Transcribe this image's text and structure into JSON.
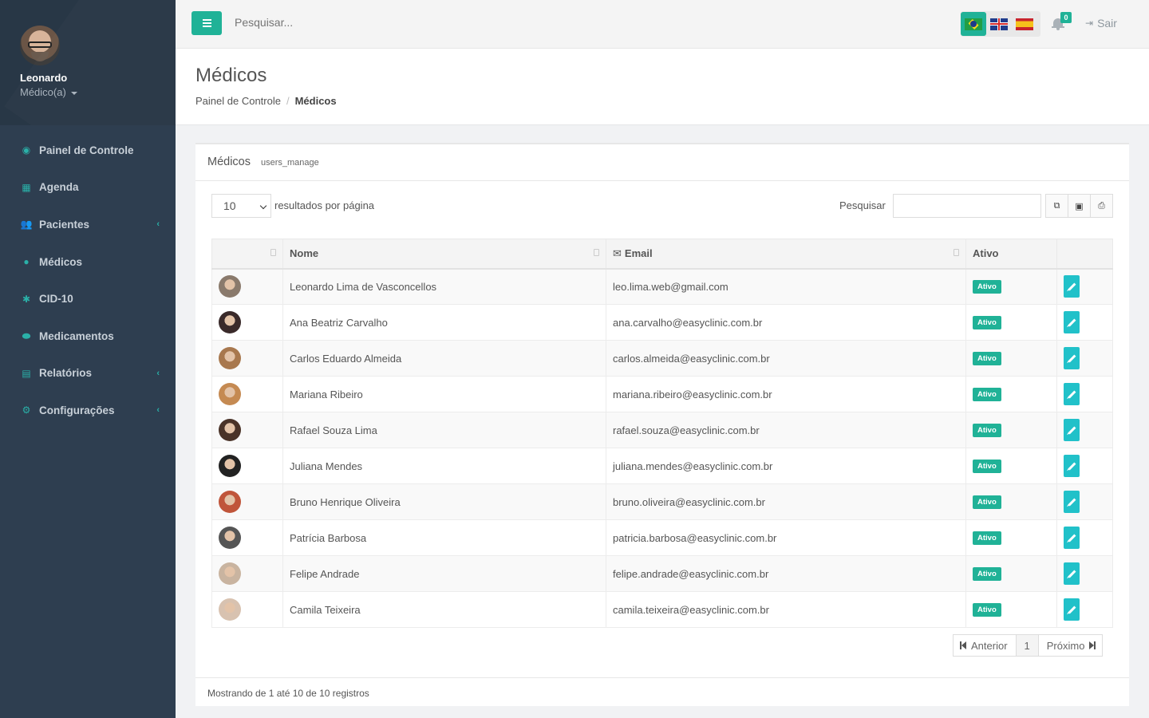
{
  "sidebar": {
    "user_name": "Leonardo",
    "user_role": "Médico(a)",
    "items": [
      {
        "label": "Painel de Controle",
        "icon": "dashboard-icon",
        "glyph": "◉",
        "has_submenu": false
      },
      {
        "label": "Agenda",
        "icon": "calendar-icon",
        "glyph": "▦",
        "has_submenu": false
      },
      {
        "label": "Pacientes",
        "icon": "users-icon",
        "glyph": "👥",
        "has_submenu": true
      },
      {
        "label": "Médicos",
        "icon": "user-md-icon",
        "glyph": "●",
        "has_submenu": false
      },
      {
        "label": "CID-10",
        "icon": "bug-icon",
        "glyph": "✱",
        "has_submenu": false
      },
      {
        "label": "Medicamentos",
        "icon": "pill-icon",
        "glyph": "⬬",
        "has_submenu": false
      },
      {
        "label": "Relatórios",
        "icon": "report-icon",
        "glyph": "▤",
        "has_submenu": true
      },
      {
        "label": "Configurações",
        "icon": "cogs-icon",
        "glyph": "⚙",
        "has_submenu": true
      }
    ]
  },
  "topbar": {
    "search_placeholder": "Pesquisar...",
    "notification_count": "0",
    "logout_label": "Sair",
    "languages": [
      "pt-BR",
      "en-GB",
      "es"
    ]
  },
  "header": {
    "title": "Médicos",
    "breadcrumb": [
      "Painel de Controle",
      "Médicos"
    ]
  },
  "card": {
    "title": "Médicos",
    "subtitle": "users_manage",
    "page_length": "10",
    "page_length_label": "resultados por página",
    "search_label": "Pesquisar",
    "columns": [
      "",
      "Nome",
      "Email",
      "Ativo",
      ""
    ],
    "rows": [
      {
        "name": "Leonardo Lima de Vasconcellos",
        "email": "leo.lima.web@gmail.com",
        "status": "Ativo",
        "avatar_color": "#8a7a6c"
      },
      {
        "name": "Ana Beatriz Carvalho",
        "email": "ana.carvalho@easyclinic.com.br",
        "status": "Ativo",
        "avatar_color": "#3a2a2a"
      },
      {
        "name": "Carlos Eduardo Almeida",
        "email": "carlos.almeida@easyclinic.com.br",
        "status": "Ativo",
        "avatar_color": "#a8784e"
      },
      {
        "name": "Mariana Ribeiro",
        "email": "mariana.ribeiro@easyclinic.com.br",
        "status": "Ativo",
        "avatar_color": "#c58a52"
      },
      {
        "name": "Rafael Souza Lima",
        "email": "rafael.souza@easyclinic.com.br",
        "status": "Ativo",
        "avatar_color": "#4a3328"
      },
      {
        "name": "Juliana Mendes",
        "email": "juliana.mendes@easyclinic.com.br",
        "status": "Ativo",
        "avatar_color": "#222222"
      },
      {
        "name": "Bruno Henrique Oliveira",
        "email": "bruno.oliveira@easyclinic.com.br",
        "status": "Ativo",
        "avatar_color": "#c0553a"
      },
      {
        "name": "Patrícia Barbosa",
        "email": "patricia.barbosa@easyclinic.com.br",
        "status": "Ativo",
        "avatar_color": "#555555"
      },
      {
        "name": "Felipe Andrade",
        "email": "felipe.andrade@easyclinic.com.br",
        "status": "Ativo",
        "avatar_color": "#c9b4a0"
      },
      {
        "name": "Camila Teixeira",
        "email": "camila.teixeira@easyclinic.com.br",
        "status": "Ativo",
        "avatar_color": "#d8c2b0"
      }
    ],
    "pager": {
      "prev": "Anterior",
      "page": "1",
      "next": "Próximo"
    },
    "footer": "Mostrando de 1 até 10 de 10 registros"
  },
  "colors": {
    "accent": "#20b297",
    "edit": "#21c1c9",
    "sidebar_bg": "#2e3e50"
  }
}
